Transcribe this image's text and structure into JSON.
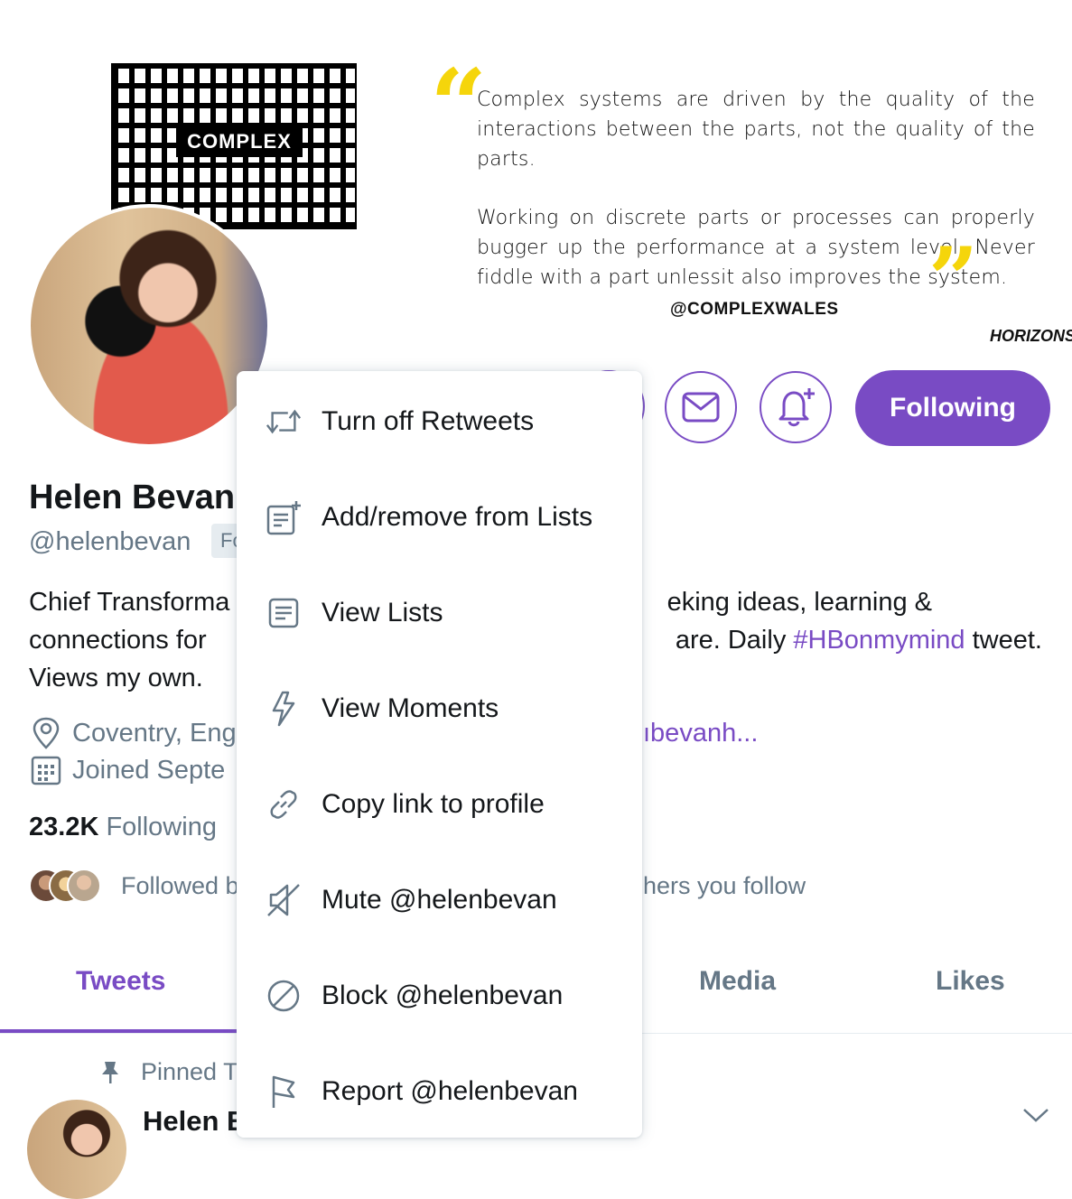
{
  "banner": {
    "maze_word": "COMPLEX",
    "quote_paragraph_1": "Complex systems are driven by the quality of the interactions between the parts, not the quality of the parts.",
    "quote_paragraph_2": "Working on discrete parts or processes can properly bugger up the performance at a system level. Never fiddle with a part unlessit also improves the system.",
    "quote_handle": "@COMPLEXWALES",
    "brand": "HORIZONS",
    "accent_color": "#f5d50b"
  },
  "profile": {
    "name": "Helen Bevan",
    "handle": "@helenbevan",
    "follows_badge": "Follows you",
    "bio_line1_left": "Chief Transforma",
    "bio_line1_right": "eking ideas, learning &",
    "bio_line2_left": "connections for",
    "bio_line2_right": "are. Daily ",
    "bio_hashtag": "#HBonmymind",
    "bio_line2_end": " tweet.",
    "bio_line3": "Views my own.",
    "location": "Coventry, Eng",
    "link_fragment": "ıbevanh...",
    "joined": "Joined Septe",
    "following_count": "23.2K",
    "following_label": "Following",
    "followed_by_left": "Followed b",
    "followed_by_right": "hers you follow",
    "following_button": "Following",
    "brand_color": "#794bc4"
  },
  "tabs": [
    {
      "label": "Tweets",
      "active": true
    },
    {
      "label": "Media",
      "active": false
    },
    {
      "label": "Likes",
      "active": false
    }
  ],
  "pinned": {
    "label": "Pinned T",
    "author": "Helen E"
  },
  "menu": {
    "items": [
      {
        "label": "Turn off Retweets",
        "icon": "retweet-icon"
      },
      {
        "label": "Add/remove from Lists",
        "icon": "list-add-icon"
      },
      {
        "label": "View Lists",
        "icon": "lists-icon"
      },
      {
        "label": "View Moments",
        "icon": "lightning-icon"
      },
      {
        "label": "Copy link to profile",
        "icon": "link-icon"
      },
      {
        "label": "Mute @helenbevan",
        "icon": "mute-icon"
      },
      {
        "label": "Block @helenbevan",
        "icon": "block-icon"
      },
      {
        "label": "Report @helenbevan",
        "icon": "flag-icon"
      }
    ]
  }
}
